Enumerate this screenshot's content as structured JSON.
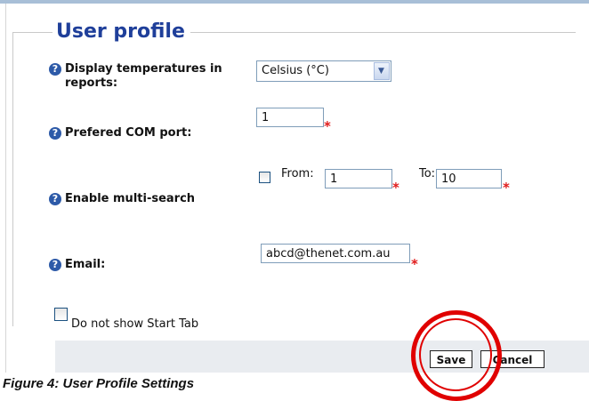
{
  "form": {
    "title": "User profile",
    "temperature": {
      "label": "Display temperatures in reports:",
      "selected": "Celsius (°C)"
    },
    "com_port": {
      "label": "Prefered COM port:",
      "value": "1"
    },
    "multi_search": {
      "label": "Enable multi-search",
      "checked": false,
      "from_label": "From:",
      "from_value": "1",
      "to_label": "To:",
      "to_value": "10"
    },
    "email": {
      "label": "Email:",
      "value": "abcd@thenet.com.au"
    },
    "start_tab": {
      "label": "Do not show Start Tab",
      "checked": false
    },
    "required_mark": "*",
    "help_glyph": "?"
  },
  "actions": {
    "save_label": "Save",
    "cancel_label": "Cancel"
  },
  "caption": "Figure 4: User Profile Settings",
  "colors": {
    "title": "#1f3f9a",
    "help_icon": "#2d5aa8",
    "required": "#e01b1b",
    "highlight_ring": "#e00000",
    "footer_bg": "#e9ecf0"
  }
}
